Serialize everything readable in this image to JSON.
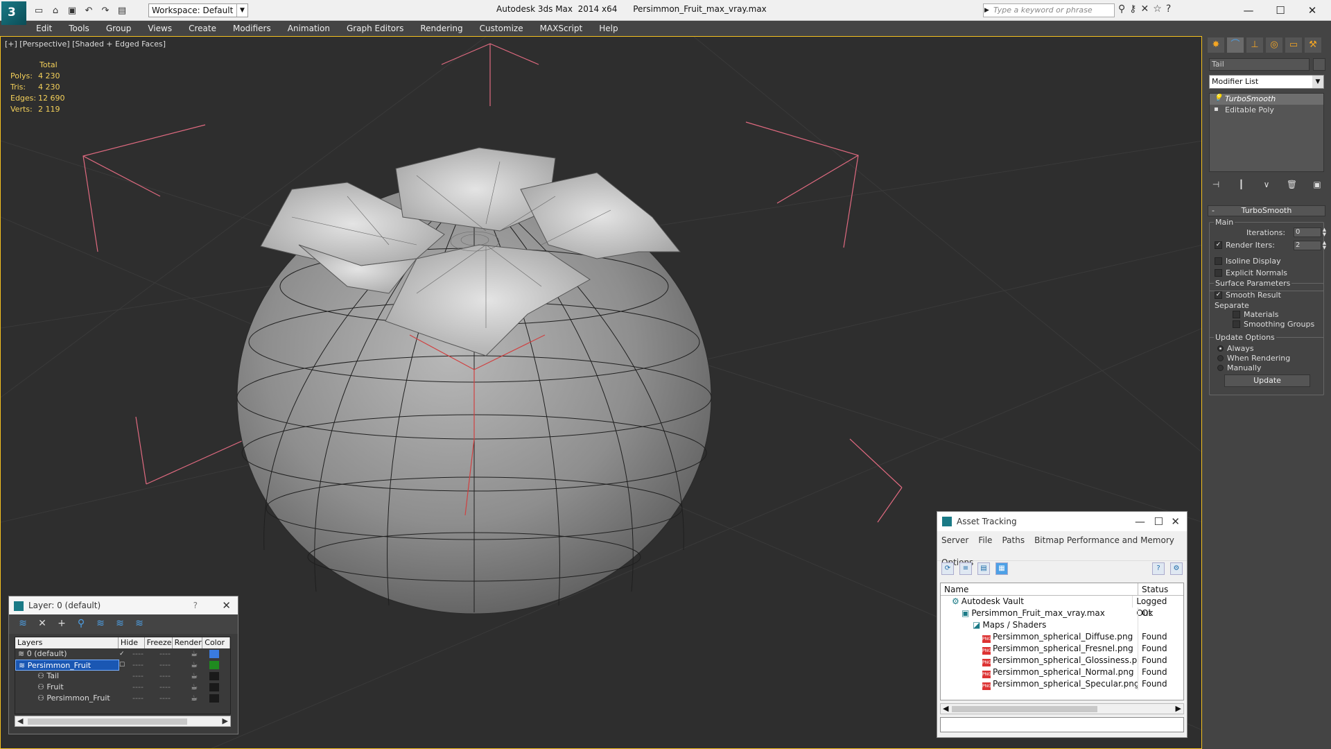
{
  "title": {
    "workspace": "Workspace: Default",
    "app": "Autodesk 3ds Max  2014 x64      Persimmon_Fruit_max_vray.max",
    "search_placeholder": "Type a keyword or phrase"
  },
  "menu": [
    "Edit",
    "Tools",
    "Group",
    "Views",
    "Create",
    "Modifiers",
    "Animation",
    "Graph Editors",
    "Rendering",
    "Customize",
    "MAXScript",
    "Help"
  ],
  "viewport": {
    "label": "[+] [Perspective] [Shaded + Edged Faces]",
    "stats": {
      "header": "Total",
      "rows": [
        {
          "k": "Polys:",
          "v": "4 230"
        },
        {
          "k": "Tris:",
          "v": "4 230"
        },
        {
          "k": "Edges:",
          "v": "12 690"
        },
        {
          "k": "Verts:",
          "v": "2 119"
        }
      ]
    }
  },
  "layers": {
    "title": "Layer: 0 (default)",
    "help": "?",
    "columns": [
      "Layers",
      "Hide",
      "Freeze",
      "Render",
      "Color"
    ],
    "rows": [
      {
        "name": "0 (default)",
        "indent": 0,
        "color": "#3a7be0",
        "check": "✓"
      },
      {
        "name": "Persimmon_Fruit",
        "indent": 0,
        "color": "#1f8a1f",
        "check": "☐"
      },
      {
        "name": "Tail",
        "indent": 1,
        "color": "#1a1a1a",
        "check": ""
      },
      {
        "name": "Fruit",
        "indent": 1,
        "color": "#1a1a1a",
        "check": ""
      },
      {
        "name": "Persimmon_Fruit",
        "indent": 1,
        "color": "#1a1a1a",
        "check": ""
      }
    ],
    "dash": "----"
  },
  "asset": {
    "title": "Asset Tracking",
    "menu": [
      "Server",
      "File",
      "Paths",
      "Bitmap Performance and Memory",
      "Options"
    ],
    "columns": [
      "Name",
      "Status"
    ],
    "rows": [
      {
        "name": "Autodesk Vault",
        "status": "Logged Out",
        "indent": 16,
        "icon": "vault"
      },
      {
        "name": "Persimmon_Fruit_max_vray.max",
        "status": "Ok",
        "indent": 30,
        "icon": "max"
      },
      {
        "name": "Maps / Shaders",
        "status": "",
        "indent": 46,
        "icon": "maps"
      },
      {
        "name": "Persimmon_spherical_Diffuse.png",
        "status": "Found",
        "indent": 60,
        "icon": "png"
      },
      {
        "name": "Persimmon_spherical_Fresnel.png",
        "status": "Found",
        "indent": 60,
        "icon": "png"
      },
      {
        "name": "Persimmon_spherical_Glossiness.png",
        "status": "Found",
        "indent": 60,
        "icon": "png"
      },
      {
        "name": "Persimmon_spherical_Normal.png",
        "status": "Found",
        "indent": 60,
        "icon": "png"
      },
      {
        "name": "Persimmon_spherical_Specular.png",
        "status": "Found",
        "indent": 60,
        "icon": "png"
      }
    ]
  },
  "command": {
    "object_name": "Tail",
    "modifier_list": "Modifier List",
    "stack": [
      "TurboSmooth",
      "Editable Poly"
    ],
    "rollout": "TurboSmooth",
    "main_group": "Main",
    "iterations_label": "Iterations:",
    "iterations_value": "0",
    "render_iters_label": "Render Iters:",
    "render_iters_value": "2",
    "isoline": "Isoline Display",
    "explicit_normals": "Explicit Normals",
    "surface_group": "Surface Parameters",
    "smooth_result": "Smooth Result",
    "separate": "Separate",
    "materials": "Materials",
    "smoothing_groups": "Smoothing Groups",
    "update_group": "Update Options",
    "always": "Always",
    "when_rendering": "When Rendering",
    "manually": "Manually",
    "update_button": "Update"
  },
  "colors": {
    "accent": "#f6c21f",
    "selection": "#1a57b3",
    "stats": "#f5d15a"
  }
}
